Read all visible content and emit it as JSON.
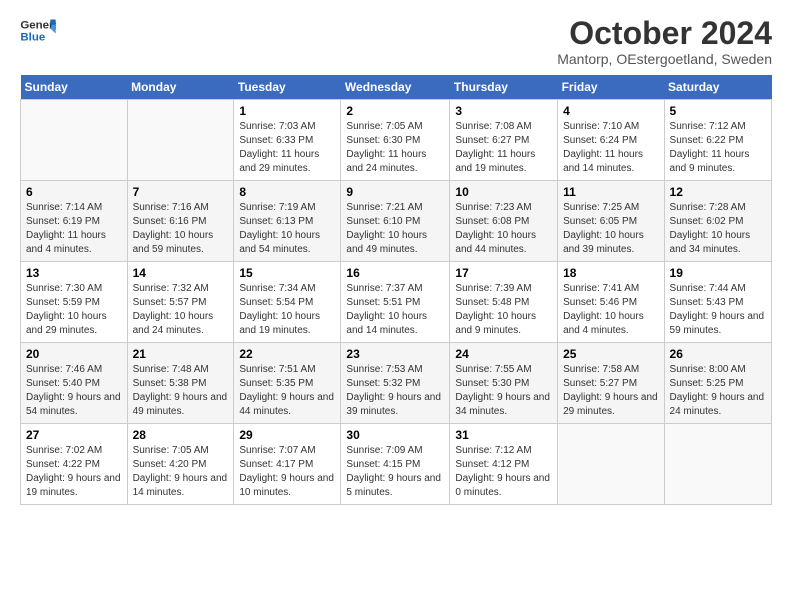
{
  "header": {
    "logo_line1": "General",
    "logo_line2": "Blue",
    "month": "October 2024",
    "location": "Mantorp, OEstergoetland, Sweden"
  },
  "days_of_week": [
    "Sunday",
    "Monday",
    "Tuesday",
    "Wednesday",
    "Thursday",
    "Friday",
    "Saturday"
  ],
  "weeks": [
    [
      {
        "day": "",
        "info": ""
      },
      {
        "day": "",
        "info": ""
      },
      {
        "day": "1",
        "info": "Sunrise: 7:03 AM\nSunset: 6:33 PM\nDaylight: 11 hours and 29 minutes."
      },
      {
        "day": "2",
        "info": "Sunrise: 7:05 AM\nSunset: 6:30 PM\nDaylight: 11 hours and 24 minutes."
      },
      {
        "day": "3",
        "info": "Sunrise: 7:08 AM\nSunset: 6:27 PM\nDaylight: 11 hours and 19 minutes."
      },
      {
        "day": "4",
        "info": "Sunrise: 7:10 AM\nSunset: 6:24 PM\nDaylight: 11 hours and 14 minutes."
      },
      {
        "day": "5",
        "info": "Sunrise: 7:12 AM\nSunset: 6:22 PM\nDaylight: 11 hours and 9 minutes."
      }
    ],
    [
      {
        "day": "6",
        "info": "Sunrise: 7:14 AM\nSunset: 6:19 PM\nDaylight: 11 hours and 4 minutes."
      },
      {
        "day": "7",
        "info": "Sunrise: 7:16 AM\nSunset: 6:16 PM\nDaylight: 10 hours and 59 minutes."
      },
      {
        "day": "8",
        "info": "Sunrise: 7:19 AM\nSunset: 6:13 PM\nDaylight: 10 hours and 54 minutes."
      },
      {
        "day": "9",
        "info": "Sunrise: 7:21 AM\nSunset: 6:10 PM\nDaylight: 10 hours and 49 minutes."
      },
      {
        "day": "10",
        "info": "Sunrise: 7:23 AM\nSunset: 6:08 PM\nDaylight: 10 hours and 44 minutes."
      },
      {
        "day": "11",
        "info": "Sunrise: 7:25 AM\nSunset: 6:05 PM\nDaylight: 10 hours and 39 minutes."
      },
      {
        "day": "12",
        "info": "Sunrise: 7:28 AM\nSunset: 6:02 PM\nDaylight: 10 hours and 34 minutes."
      }
    ],
    [
      {
        "day": "13",
        "info": "Sunrise: 7:30 AM\nSunset: 5:59 PM\nDaylight: 10 hours and 29 minutes."
      },
      {
        "day": "14",
        "info": "Sunrise: 7:32 AM\nSunset: 5:57 PM\nDaylight: 10 hours and 24 minutes."
      },
      {
        "day": "15",
        "info": "Sunrise: 7:34 AM\nSunset: 5:54 PM\nDaylight: 10 hours and 19 minutes."
      },
      {
        "day": "16",
        "info": "Sunrise: 7:37 AM\nSunset: 5:51 PM\nDaylight: 10 hours and 14 minutes."
      },
      {
        "day": "17",
        "info": "Sunrise: 7:39 AM\nSunset: 5:48 PM\nDaylight: 10 hours and 9 minutes."
      },
      {
        "day": "18",
        "info": "Sunrise: 7:41 AM\nSunset: 5:46 PM\nDaylight: 10 hours and 4 minutes."
      },
      {
        "day": "19",
        "info": "Sunrise: 7:44 AM\nSunset: 5:43 PM\nDaylight: 9 hours and 59 minutes."
      }
    ],
    [
      {
        "day": "20",
        "info": "Sunrise: 7:46 AM\nSunset: 5:40 PM\nDaylight: 9 hours and 54 minutes."
      },
      {
        "day": "21",
        "info": "Sunrise: 7:48 AM\nSunset: 5:38 PM\nDaylight: 9 hours and 49 minutes."
      },
      {
        "day": "22",
        "info": "Sunrise: 7:51 AM\nSunset: 5:35 PM\nDaylight: 9 hours and 44 minutes."
      },
      {
        "day": "23",
        "info": "Sunrise: 7:53 AM\nSunset: 5:32 PM\nDaylight: 9 hours and 39 minutes."
      },
      {
        "day": "24",
        "info": "Sunrise: 7:55 AM\nSunset: 5:30 PM\nDaylight: 9 hours and 34 minutes."
      },
      {
        "day": "25",
        "info": "Sunrise: 7:58 AM\nSunset: 5:27 PM\nDaylight: 9 hours and 29 minutes."
      },
      {
        "day": "26",
        "info": "Sunrise: 8:00 AM\nSunset: 5:25 PM\nDaylight: 9 hours and 24 minutes."
      }
    ],
    [
      {
        "day": "27",
        "info": "Sunrise: 7:02 AM\nSunset: 4:22 PM\nDaylight: 9 hours and 19 minutes."
      },
      {
        "day": "28",
        "info": "Sunrise: 7:05 AM\nSunset: 4:20 PM\nDaylight: 9 hours and 14 minutes."
      },
      {
        "day": "29",
        "info": "Sunrise: 7:07 AM\nSunset: 4:17 PM\nDaylight: 9 hours and 10 minutes."
      },
      {
        "day": "30",
        "info": "Sunrise: 7:09 AM\nSunset: 4:15 PM\nDaylight: 9 hours and 5 minutes."
      },
      {
        "day": "31",
        "info": "Sunrise: 7:12 AM\nSunset: 4:12 PM\nDaylight: 9 hours and 0 minutes."
      },
      {
        "day": "",
        "info": ""
      },
      {
        "day": "",
        "info": ""
      }
    ]
  ]
}
